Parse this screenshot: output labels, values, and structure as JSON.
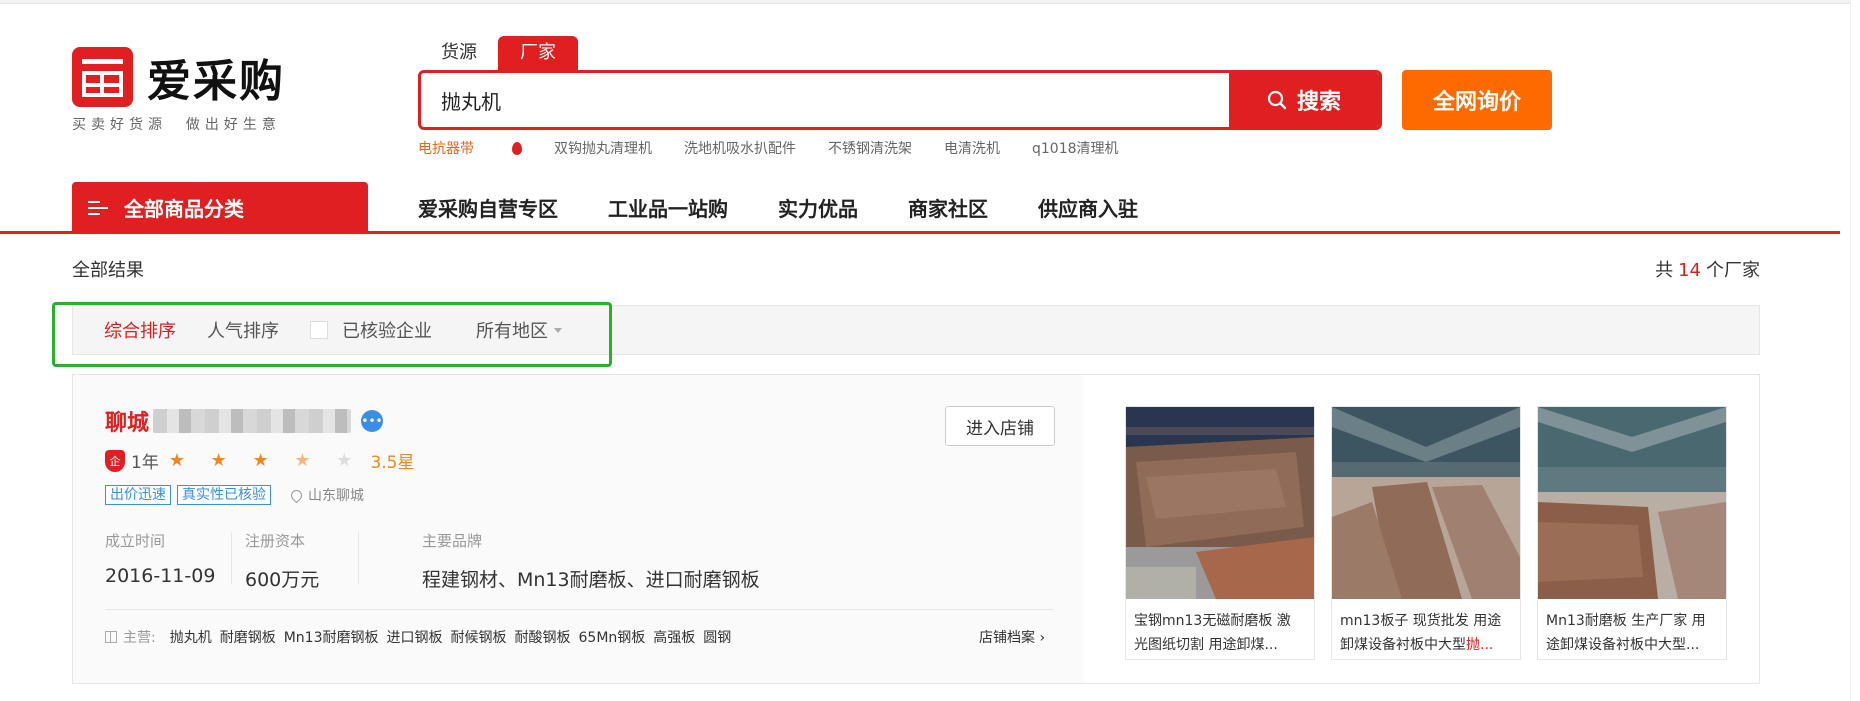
{
  "header": {
    "logo_name": "爱采购",
    "logo_slogan": "买卖好货源  做出好生意",
    "tabs": [
      "货源",
      "厂家"
    ],
    "search_value": "抛丸机",
    "search_button": "搜索",
    "inquiry_button": "全网询价",
    "hot_words": [
      "电抗器带",
      "双钩抛丸清理机",
      "洗地机吸水扒配件",
      "不锈钢清洗架",
      "电清洗机",
      "q1018清理机"
    ]
  },
  "nav": {
    "category_menu": "全部商品分类",
    "items": [
      "爱采购自营专区",
      "工业品一站购",
      "实力优品",
      "商家社区",
      "供应商入驻"
    ]
  },
  "results": {
    "label": "全部结果",
    "total_prefix": "共",
    "total_count": "14",
    "total_suffix": "个厂家"
  },
  "sort_bar": {
    "comprehensive": "综合排序",
    "popularity": "人气排序",
    "verified": "已核验企业",
    "region": "所有地区"
  },
  "company": {
    "name_visible": "聊城",
    "years": "1年",
    "stars_full": "★ ★ ★",
    "star_half": "★",
    "star_empty": "★",
    "rating": 3.5,
    "rating_text": "3.5星",
    "badges": [
      "出价迅速",
      "真实性已核验"
    ],
    "location": "山东聊城",
    "established_label": "成立时间",
    "established_value": "2016-11-09",
    "capital_label": "注册资本",
    "capital_value": "600万元",
    "brands_label": "主要品牌",
    "brands_value": "程建钢材、Mn13耐磨板、进口耐磨钢板",
    "main_business_label": "主营:",
    "main_business": [
      "抛丸机",
      "耐磨钢板",
      "Mn13耐磨钢板",
      "进口钢板",
      "耐候钢板",
      "耐酸钢板",
      "65Mn钢板",
      "高强板",
      "圆钢"
    ],
    "shop_archive": "店铺档案",
    "enter_shop": "进入店铺"
  },
  "products": [
    {
      "caption_line1": "宝钢mn13无磁耐磨板 激",
      "caption_line2": "光图纸切割 用途卸煤..."
    },
    {
      "caption_line1": "mn13板子 现货批发 用途",
      "caption_line2": "卸煤设备衬板中大型",
      "caption_hl": "抛..."
    },
    {
      "caption_line1": "Mn13耐磨板 生产厂家 用",
      "caption_line2": "途卸煤设备衬板中大型..."
    }
  ],
  "colors": {
    "brand_red": "#e02020",
    "inquiry_orange": "#ff6a00",
    "highlight_green": "#2bb02b",
    "star_orange": "#f08a1c",
    "badge_blue": "#3a8ee6"
  }
}
